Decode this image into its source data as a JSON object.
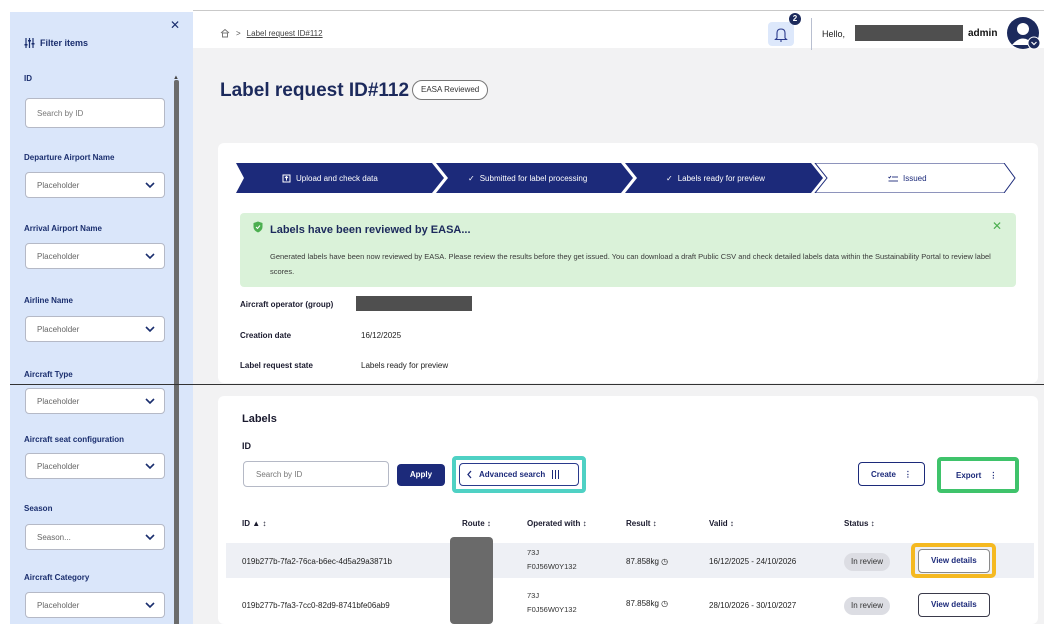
{
  "sidebar": {
    "title": "Filter items",
    "filters": [
      {
        "label": "ID",
        "placeholder": "Search by ID"
      },
      {
        "label": "Departure Airport Name",
        "value": "Placeholder"
      },
      {
        "label": "Arrival Airport Name",
        "value": "Placeholder"
      },
      {
        "label": "Airline Name",
        "value": "Placeholder"
      },
      {
        "label": "Aircraft Type",
        "value": "Placeholder"
      },
      {
        "label": "Aircraft seat configuration",
        "value": "Placeholder"
      },
      {
        "label": "Season",
        "value": "Season..."
      },
      {
        "label": "Aircraft Category",
        "value": "Placeholder"
      }
    ]
  },
  "header": {
    "breadcrumb": "Label request ID#112",
    "notification_count": "2",
    "greeting": "Hello,",
    "user_role": "admin"
  },
  "page": {
    "title": "Label request ID#112",
    "badge": "EASA Reviewed"
  },
  "stepper": {
    "steps": [
      {
        "label": "Upload and check data",
        "state": "done"
      },
      {
        "label": "Submitted for label processing",
        "state": "done"
      },
      {
        "label": "Labels ready for preview",
        "state": "current"
      },
      {
        "label": "Issued",
        "state": "pending"
      }
    ]
  },
  "alert": {
    "title": "Labels have been reviewed by EASA...",
    "text": "Generated labels have been now reviewed by EASA. Please review the results before they get issued. You can download a draft Public CSV and check detailed labels data within the Sustainability Portal to review label scores."
  },
  "details": {
    "operator_label": "Aircraft operator (group)",
    "creation_label": "Creation date",
    "creation_value": "16/12/2025",
    "state_label": "Label request state",
    "state_value": "Labels ready for preview"
  },
  "labels": {
    "heading": "Labels",
    "id_label": "ID",
    "search_placeholder": "Search by ID",
    "apply": "Apply",
    "advanced_search": "Advanced search",
    "create": "Create",
    "export": "Export",
    "columns": [
      "ID ▲ ↕",
      "Route ↕",
      "Operated with ↕",
      "Result ↕",
      "Valid ↕",
      "Status ↕"
    ],
    "rows": [
      {
        "id": "019b277b-7fa2-76ca-b6ec-4d5a29a3871b",
        "op_line1": "73J",
        "op_line2": "F0J56W0Y132",
        "result": "87.858kg",
        "valid": "16/12/2025 - 24/10/2026",
        "status": "In review",
        "action": "View details"
      },
      {
        "id": "019b277b-7fa3-7cc0-82d9-8741bfe06ab9",
        "op_line1": "73J",
        "op_line2": "F0J56W0Y132",
        "result": "87.858kg",
        "valid": "28/10/2026 - 30/10/2027",
        "status": "In review",
        "action": "View details"
      }
    ]
  },
  "colors": {
    "primary": "#1c2a7a",
    "sidebar_bg": "#dae6fa",
    "alert_bg": "#daf2d9",
    "highlight_teal": "#4fd1c4",
    "highlight_green": "#3fc36b",
    "highlight_yellow": "#f5b921"
  }
}
